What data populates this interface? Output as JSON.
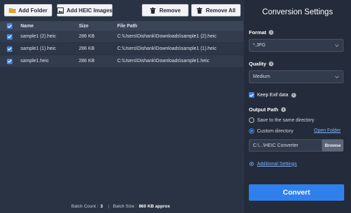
{
  "toolbar": {
    "add_folder": "Add Folder",
    "add_heic_images": "Add HEIC Images",
    "remove": "Remove",
    "remove_all": "Remove All"
  },
  "table": {
    "headers": {
      "name": "Name",
      "size": "Size",
      "path": "File Path"
    },
    "rows": [
      {
        "name": "sample1 (2).heic",
        "size": "286 KB",
        "path": "C:\\Users\\Dishank\\Downloads\\sample1 (2).heic",
        "checked": true
      },
      {
        "name": "sample1 (1).heic",
        "size": "286 KB",
        "path": "C:\\Users\\Dishank\\Downloads\\sample1 (1).heic",
        "checked": true
      },
      {
        "name": "sample1.heic",
        "size": "286 KB",
        "path": "C:\\Users\\Dishank\\Downloads\\sample1.heic",
        "checked": true
      }
    ]
  },
  "footer": {
    "batch_count_label": "Batch Count :",
    "batch_count": "3",
    "batch_size_label": "Batch Size :",
    "batch_size": "860 KB approx"
  },
  "settings": {
    "title": "Conversion Settings",
    "format_label": "Format",
    "format_value": "*.JPG",
    "quality_label": "Quality",
    "quality_value": "Medium",
    "keep_exif_label": "Keep Exif data",
    "keep_exif_checked": true,
    "output_path_label": "Output Path",
    "save_same_label": "Save to the same directory",
    "custom_dir_label": "Custom directory",
    "open_folder": "Open Folder",
    "path_value": "C:\\...\\HEIC Converter",
    "browse": "Browse",
    "additional_settings": "Additional Settings",
    "convert": "Convert"
  },
  "colors": {
    "accent": "#2f80ed",
    "link": "#7fb2ff",
    "panel_left": "#2a3344",
    "panel_right": "#242c3b"
  }
}
